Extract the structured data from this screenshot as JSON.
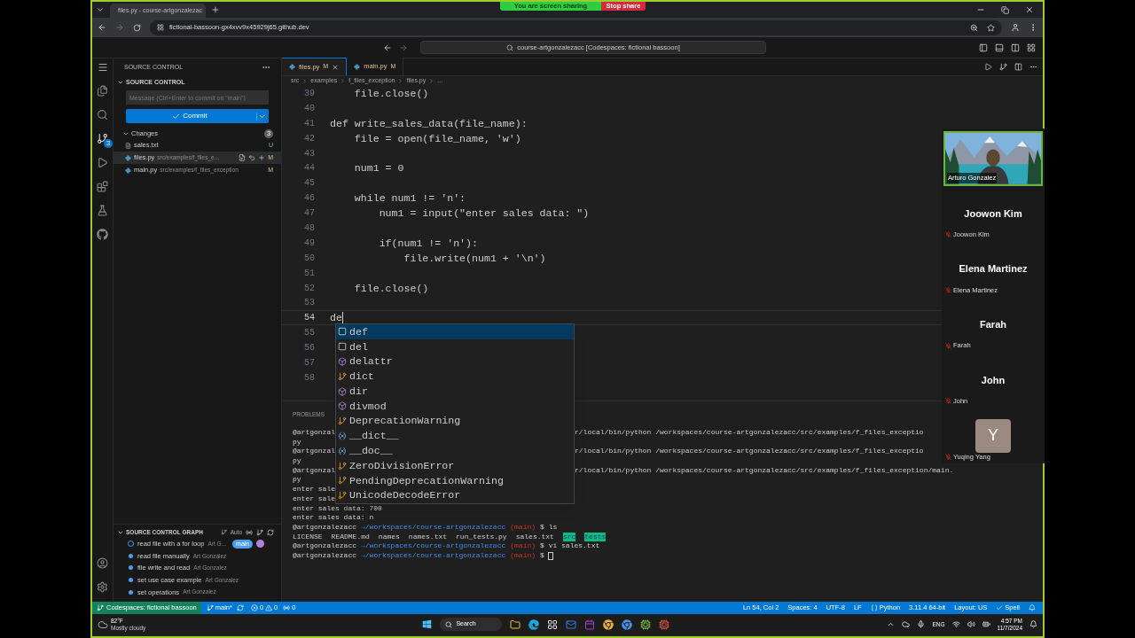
{
  "browser": {
    "tab": {
      "title": "files.py - course-artgonzalezac",
      "selected": true
    },
    "url": "fictional-bassoon-gx4xvv9x45929j65.github.dev"
  },
  "sharing": {
    "message": "You are screen sharing",
    "stop": "Stop share"
  },
  "vscode": {
    "command_center": "course-artgonzalezacc [Codespaces: fictional bassoon]",
    "scm_badge": "3"
  },
  "sidebar": {
    "title": "SOURCE CONTROL",
    "section": "SOURCE CONTROL",
    "commit_placeholder": "Message (Ctrl+Enter to commit on \"main\")",
    "commit_button": "Commit",
    "changes": {
      "label": "Changes",
      "count": "3",
      "expanded": true,
      "files": [
        {
          "name": "sales.txt",
          "status": "U",
          "kind": "text",
          "selected": false
        },
        {
          "name": "files.py",
          "path": "src/examples/f_files_e...",
          "status": "M",
          "kind": "python",
          "selected": true
        },
        {
          "name": "main.py",
          "path": "src/examples/f_files_exception",
          "status": "M",
          "kind": "python",
          "selected": false
        }
      ]
    },
    "graph": {
      "title": "SOURCE CONTROL GRAPH",
      "mode": "Auto",
      "commits": [
        {
          "message": "read file with a for loop",
          "author": "Art G...",
          "branch": "main",
          "head": true
        },
        {
          "message": "read file manually",
          "author": "Art Gonzalez",
          "head": false
        },
        {
          "message": "file write and read",
          "author": "Art Gonzalez",
          "head": false
        },
        {
          "message": "set use case example",
          "author": "Art Gonzalez",
          "head": false
        },
        {
          "message": "set operations",
          "author": "Art Gonzalez",
          "head": false
        }
      ]
    }
  },
  "editor": {
    "tabs": [
      {
        "name": "files.py",
        "status": "M",
        "selected": true
      },
      {
        "name": "main.py",
        "status": "M",
        "selected": false
      }
    ],
    "breadcrumb": [
      "src",
      "examples",
      "f_files_exception",
      "files.py",
      "..."
    ],
    "lines": [
      {
        "number": "39",
        "text": "    file.close()",
        "current": false
      },
      {
        "number": "40",
        "current": false
      },
      {
        "number": "41",
        "text": "def write_sales_data(file_name):",
        "current": false
      },
      {
        "number": "42",
        "text": "    file = open(file_name, 'w')",
        "current": false
      },
      {
        "number": "43",
        "current": false
      },
      {
        "number": "44",
        "text": "    num1 = 0",
        "current": false
      },
      {
        "number": "45",
        "current": false
      },
      {
        "number": "46",
        "text": "    while num1 != 'n':",
        "current": false
      },
      {
        "number": "47",
        "text": "        num1 = input(\"enter sales data: \")",
        "current": false
      },
      {
        "number": "48",
        "current": false
      },
      {
        "number": "49",
        "text": "        if(num1 != 'n'):",
        "current": false
      },
      {
        "number": "50",
        "text": "            file.write(num1 + '\\n')",
        "current": false
      },
      {
        "number": "51",
        "current": false
      },
      {
        "number": "52",
        "text": "    file.close()",
        "current": false
      },
      {
        "number": "53",
        "current": false
      },
      {
        "number": "54",
        "text": "de",
        "current": true
      },
      {
        "number": "55",
        "current": false
      },
      {
        "number": "56",
        "current": false
      },
      {
        "number": "57",
        "current": false
      },
      {
        "number": "58",
        "current": false
      }
    ],
    "completion": [
      {
        "label": "def",
        "kind": "keyword",
        "selected": true
      },
      {
        "label": "del",
        "kind": "keyword",
        "selected": false
      },
      {
        "label": "delattr",
        "kind": "function",
        "selected": false
      },
      {
        "label": "dict",
        "kind": "class",
        "selected": false
      },
      {
        "label": "dir",
        "kind": "function",
        "selected": false
      },
      {
        "label": "divmod",
        "kind": "function",
        "selected": false
      },
      {
        "label": "DeprecationWarning",
        "kind": "class",
        "selected": false
      },
      {
        "label": "__dict__",
        "kind": "variable",
        "selected": false
      },
      {
        "label": "__doc__",
        "kind": "variable",
        "selected": false
      },
      {
        "label": "ZeroDivisionError",
        "kind": "class",
        "selected": false
      },
      {
        "label": "PendingDeprecationWarning",
        "kind": "class",
        "selected": false
      },
      {
        "label": "UnicodeDecodeError",
        "kind": "class",
        "selected": false
      }
    ]
  },
  "panel": {
    "tab": "PROBLEMS",
    "terminal": [
      {
        "kind": "text",
        "text": "@artgonzal",
        "tail": "r/local/bin/python /workspaces/course-artgonzalezacc/src/examples/f_files_exceptio"
      },
      {
        "kind": "text",
        "text": "py"
      },
      {
        "kind": "text",
        "text": "@artgonzal",
        "tail": "r/local/bin/python /workspaces/course-artgonzalezacc/src/examples/f_files_exceptio"
      },
      {
        "kind": "text",
        "text": "py"
      },
      {
        "kind": "text",
        "text": "@artgonzal",
        "tail": "r/local/bin/python /workspaces/course-artgonzalezacc/src/examples/f_files_exception/main."
      },
      {
        "kind": "text",
        "text": "py"
      },
      {
        "kind": "text",
        "text": "enter sale"
      },
      {
        "kind": "text",
        "text": "enter sale"
      },
      {
        "kind": "text",
        "text": "enter sales data: 700"
      },
      {
        "kind": "text",
        "text": "enter sales data: n"
      },
      {
        "kind": "prompt",
        "user": "@artgonzalezacc",
        "path": "→/workspaces/course-artgonzalezacc",
        "branch": "(main)",
        "command": "$ ls",
        "cursor": false
      },
      {
        "kind": "listing",
        "items": [
          {
            "text": "LICENSE",
            "dir": false
          },
          {
            "text": "README.md",
            "dir": false
          },
          {
            "text": "names",
            "dir": false
          },
          {
            "text": "names.txt",
            "dir": false
          },
          {
            "text": "run_tests.py",
            "dir": false
          },
          {
            "text": "sales.txt",
            "dir": false
          },
          {
            "text": "src",
            "dir": true
          },
          {
            "text": "tests",
            "dir": true
          }
        ]
      },
      {
        "kind": "prompt",
        "user": "@artgonzalezacc",
        "path": "→/workspaces/course-artgonzalezacc",
        "branch": "(main)",
        "command": "$ vi sales.txt",
        "cursor": false
      },
      {
        "kind": "prompt",
        "user": "@artgonzalezacc",
        "path": "→/workspaces/course-artgonzalezacc",
        "branch": "(main)",
        "command": "$",
        "cursor": true
      }
    ]
  },
  "participants": [
    {
      "kind": "video",
      "name": "Arturo Gonzalez"
    },
    {
      "kind": "name",
      "name": "Joowon Kim",
      "label": "Joowon Kim",
      "muted": true
    },
    {
      "kind": "name",
      "name": "Elena Martinez",
      "label": "Elena Martinez",
      "muted": true
    },
    {
      "kind": "name",
      "name": "Farah",
      "label": "Farah",
      "muted": true
    },
    {
      "kind": "name",
      "name": "John",
      "label": "John",
      "muted": true
    },
    {
      "kind": "avatar",
      "initial": "Y",
      "label": "Yuqing Yang",
      "muted": true
    }
  ],
  "status_bar": {
    "remote": "Codespaces: fictional bassoon",
    "branch": "main*",
    "errors": "0",
    "warnings": "0",
    "ports": "0",
    "items": [
      {
        "text": "Ln 54, Col 2",
        "kind": "plain"
      },
      {
        "text": "Spaces: 4",
        "kind": "plain"
      },
      {
        "text": "UTF-8",
        "kind": "plain"
      },
      {
        "text": "LF",
        "kind": "plain"
      },
      {
        "text": "Python",
        "kind": "language"
      },
      {
        "text": "3.11.4 64-bit",
        "kind": "plain"
      },
      {
        "text": "Layout: US",
        "kind": "plain"
      },
      {
        "text": "Spell",
        "kind": "check"
      }
    ]
  },
  "taskbar": {
    "weather": {
      "temp": "82°F",
      "text": "Mostly cloudy"
    },
    "search": "Search",
    "language": "ENG",
    "time": "4:57 PM",
    "date": "11/7/2024"
  }
}
